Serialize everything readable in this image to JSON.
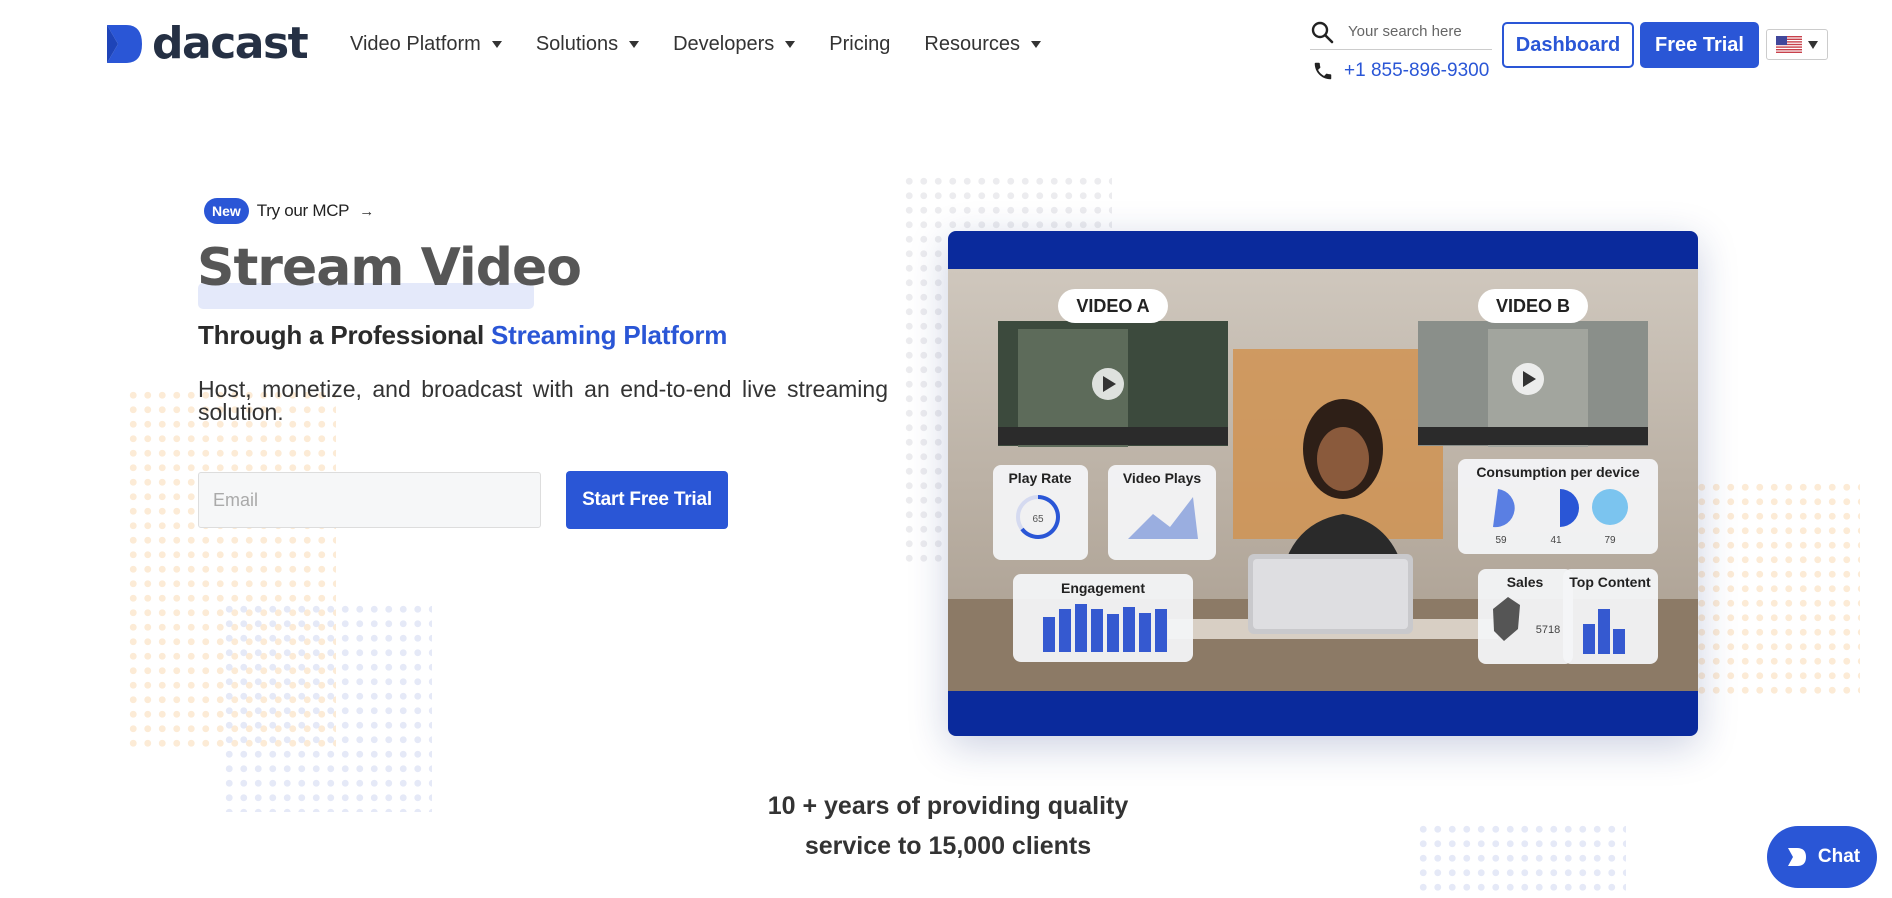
{
  "brand": {
    "name": "dacast",
    "mark_color": "#2a56d6"
  },
  "nav": {
    "items": [
      {
        "label": "Video Platform",
        "has_dropdown": true
      },
      {
        "label": "Solutions",
        "has_dropdown": true
      },
      {
        "label": "Developers",
        "has_dropdown": true
      },
      {
        "label": "Pricing",
        "has_dropdown": false
      },
      {
        "label": "Resources",
        "has_dropdown": true
      }
    ]
  },
  "header": {
    "search_placeholder": "Your search here",
    "phone": "+1 855-896-9300",
    "dashboard_label": "Dashboard",
    "free_trial_label": "Free Trial",
    "language_flag": "us-flag-icon"
  },
  "hero": {
    "badge": "New",
    "mcp_text": "Try our MCP",
    "mcp_arrow": "→",
    "title": "Stream Video",
    "subtitle_prefix": "Through a Professional ",
    "subtitle_highlight": "Streaming Platform",
    "description": "Host, monetize, and broadcast with an end-to-end live streaming solution.",
    "email_placeholder": "Email",
    "cta_label": "Start Free Trial"
  },
  "video": {
    "label_a": "VIDEO A",
    "label_b": "VIDEO B",
    "play_rate_label": "Play Rate",
    "play_rate_value": "65",
    "video_plays_label": "Video Plays",
    "consumption_label": "Consumption per device",
    "device_values": [
      "59",
      "41",
      "79"
    ],
    "engagement_label": "Engagement",
    "sales_label": "Sales",
    "sales_value": "5718",
    "top_content_label": "Top Content"
  },
  "stats": {
    "line1": "10 + years of providing quality",
    "line2": "service to 15,000 clients"
  },
  "chat": {
    "label": "Chat"
  },
  "colors": {
    "accent": "#2a56d6",
    "video_bg": "#0a2a9c",
    "text_dark": "#2b2b2b"
  }
}
